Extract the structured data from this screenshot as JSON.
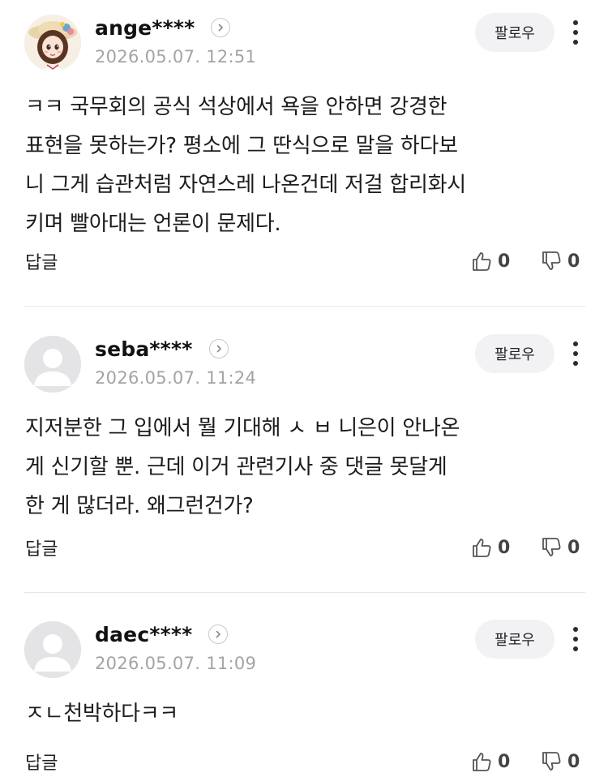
{
  "comments": [
    {
      "avatar": "profile-character-avatar",
      "nickname": "ange****",
      "date": "2026.05.07. 12:51",
      "follow_label": "팔로우",
      "text": "ㅋㅋ 국무회의 공식 석상에서 욕을 안하면 강경한\n표현을 못하는가? 평소에 그 딴식으로 말을 하다보\n니 그게 습관처럼 자연스레 나온건데 저걸 합리화시\n키며 빨아대는 언론이 문제다.",
      "reply_label": "답글",
      "likes": "0",
      "dislikes": "0"
    },
    {
      "avatar": "default-user-avatar",
      "nickname": "seba****",
      "date": "2026.05.07. 11:24",
      "follow_label": "팔로우",
      "text": "지저분한 그 입에서 뭘 기대해 ㅅ ㅂ 니은이 안나온\n게 신기할 뿐. 근데 이거 관련기사 중 댓글 못달게\n한 게 많더라. 왜그런건가?",
      "reply_label": "답글",
      "likes": "0",
      "dislikes": "0"
    },
    {
      "avatar": "default-user-avatar",
      "nickname": "daec****",
      "date": "2026.05.07. 11:09",
      "follow_label": "팔로우",
      "text": "ㅈㄴ천박하다ㅋㅋ",
      "reply_label": "답글",
      "likes": "0",
      "dislikes": "0"
    }
  ],
  "icons": {
    "chevron": "chevron-right-icon",
    "kebab": "more-options-icon",
    "like": "thumbs-up-icon",
    "dislike": "thumbs-down-icon"
  },
  "colors": {
    "text": "#1c1c1c",
    "date": "#a3a3a8",
    "follow_bg": "#f2f2f4",
    "divider": "#e6e6e8"
  }
}
